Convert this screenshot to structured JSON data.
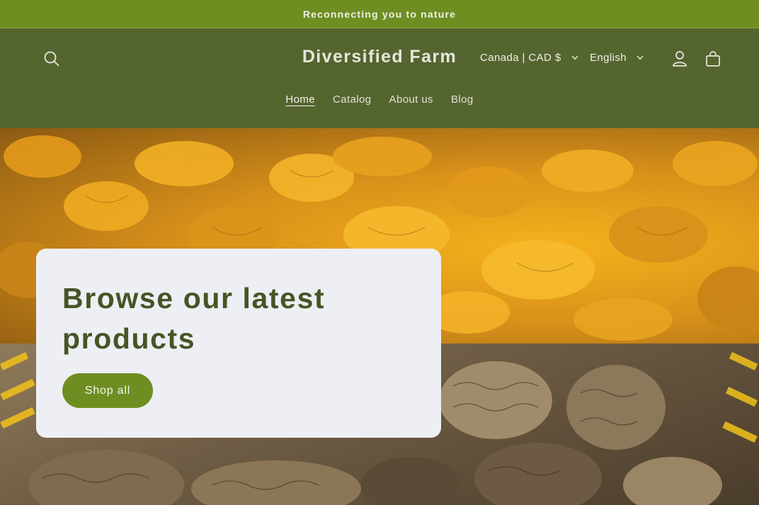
{
  "announcement": {
    "text": "Reconnecting you to nature"
  },
  "header": {
    "brand": "Diversified Farm",
    "country_selector": "Canada | CAD $",
    "language_selector": "English"
  },
  "nav": {
    "items": [
      {
        "label": "Home",
        "active": true
      },
      {
        "label": "Catalog"
      },
      {
        "label": "About us"
      },
      {
        "label": "Blog"
      }
    ]
  },
  "hero": {
    "heading": "Browse our latest products",
    "button_label": "Shop all"
  },
  "colors": {
    "announcement_bg": "#6f8e22",
    "header_bg": "#55652f",
    "card_bg": "#eeeff4",
    "heading": "#465525",
    "button_bg": "#6f8e22"
  },
  "icons": [
    "search-icon",
    "chevron-down-icon",
    "account-icon",
    "cart-icon"
  ]
}
